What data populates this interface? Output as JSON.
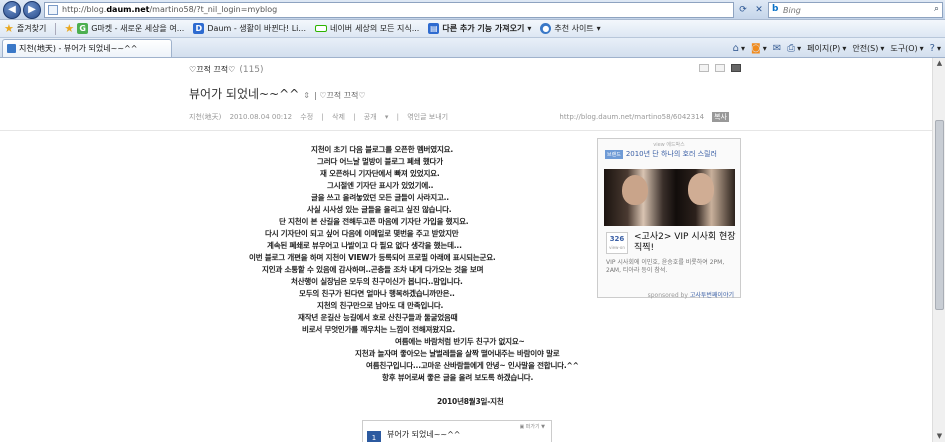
{
  "browser": {
    "url_prefix": "http://blog.",
    "url_domain": "daum.net",
    "url_suffix": "/martino58/?t_nil_login=myblog",
    "search_engine": "Bing",
    "search_placeholder": "Bing",
    "favorites": [
      {
        "label": "즐겨찾기",
        "icon": "favorites-star-icon"
      },
      {
        "label": "G마켓 - 새로운 세상을 여...",
        "icon": "gmarket-icon"
      },
      {
        "label": "Daum - 생활이 바뀐다! Li...",
        "icon": "daum-icon"
      },
      {
        "label": "네이버",
        "icon": "naver-icon"
      },
      {
        "label": "세상의 모든 지식...",
        "icon": ""
      },
      {
        "label": "다른 추가 기능 가져오기",
        "icon": "addon-icon"
      },
      {
        "label": "추천 사이트",
        "icon": "suggested-sites-icon"
      }
    ],
    "tab_title": "지천(地天) - 뷰어가 되었네~~^^",
    "commands": {
      "page": "페이지(P)",
      "safety": "안전(S)",
      "tools": "도구(O)"
    }
  },
  "blog": {
    "name": "♡끄적 끄적♡",
    "count": "(115)",
    "post_title": "뷰어가 되었네~~^^",
    "category": "| ♡끄적 끄적♡",
    "meta": {
      "author": "지천(地天)",
      "date": "2010.08.04 00:12",
      "edit": "수정",
      "delete": "삭제",
      "visibility": "공개",
      "write_trackback": "엮인글 보내기",
      "permalink": "http://blog.daum.net/martino58/6042314",
      "copy_label": "복사"
    },
    "body_lines": [
      "지천이 초기 다음 블로그를 오픈한 멤버였지요.",
      "그러다 어느날 멀방이 블로그 폐쇄 했다가",
      "재 오픈하니 기자단에서 빠져 있었지요.",
      "그시절엔 기자단 표시가 있었기에..",
      "글을 쓰고 올려놓았던 모든 글들이 사라지고..",
      "사실 시사성 있는 글들을 올리고 싶진 않습니다.",
      "단 지천이 본 산길을 전해두고픈 마음에 기자단 가입을 했지요.",
      "다시 기자단이 되고 싶어 다음에 이메일로 몇번을 주고 받았지만",
      "계속된 폐쇄로 뷰우어고 나발이고 다 필요 없다 생각을 했는데...",
      "이번 블로그 개편을 하며 지천이 VIEW가 등록되어 프로필 아래에 표시되는군요.",
      "지인과 소통할 수 있음에 감사하며..곤충들 조차 내게 다가오는 것을 보며",
      "처산행이 실장님은 모두의 친구이신가 봅니다..맘입니다.",
      "모두의 친구가 된다면 얼마나 행복하겠습니까만은..",
      "지천의 친구만으로 남아도 대 만족입니다.",
      "재작년 운길산 능길에서 호로 산친구들과 둘굴었음때",
      "비로서 무엇인가를 깨우치는 느낌이 전해져왔지요.",
      "여름에는 바람처럼 반기두 친구가 없지요~",
      "지천과 놀자며 좋아오는 날벌레들을 살짝 떨어내주는 바람이야 말로",
      "여름친구입니다...고마운 산바람들에게 안녕~ 인사말을 전합니다.^^",
      "항후 뷰어로써 좋은 글을 올려 보도록 하겠습니다.",
      "2010년8월3일-지천"
    ]
  },
  "ad": {
    "label": "view 에드박스",
    "tag": "브랜드",
    "headline": "2010년 단 하나의 호러 스릴러",
    "count": "326",
    "count_unit": "view-on",
    "title": "<고사2> VIP 시사회 현장 직찍!",
    "desc": "VIP 시사회에 이민호, 윤승호를 비롯하여 2PM, 2AM, 티아라 등이 참석.",
    "sponsored_by": "sponsored by",
    "sponsor": "고사투번째이야기"
  },
  "card": {
    "more": "▣ 퍼가기 ▼",
    "title": "뷰어가 되었네~~^^"
  }
}
